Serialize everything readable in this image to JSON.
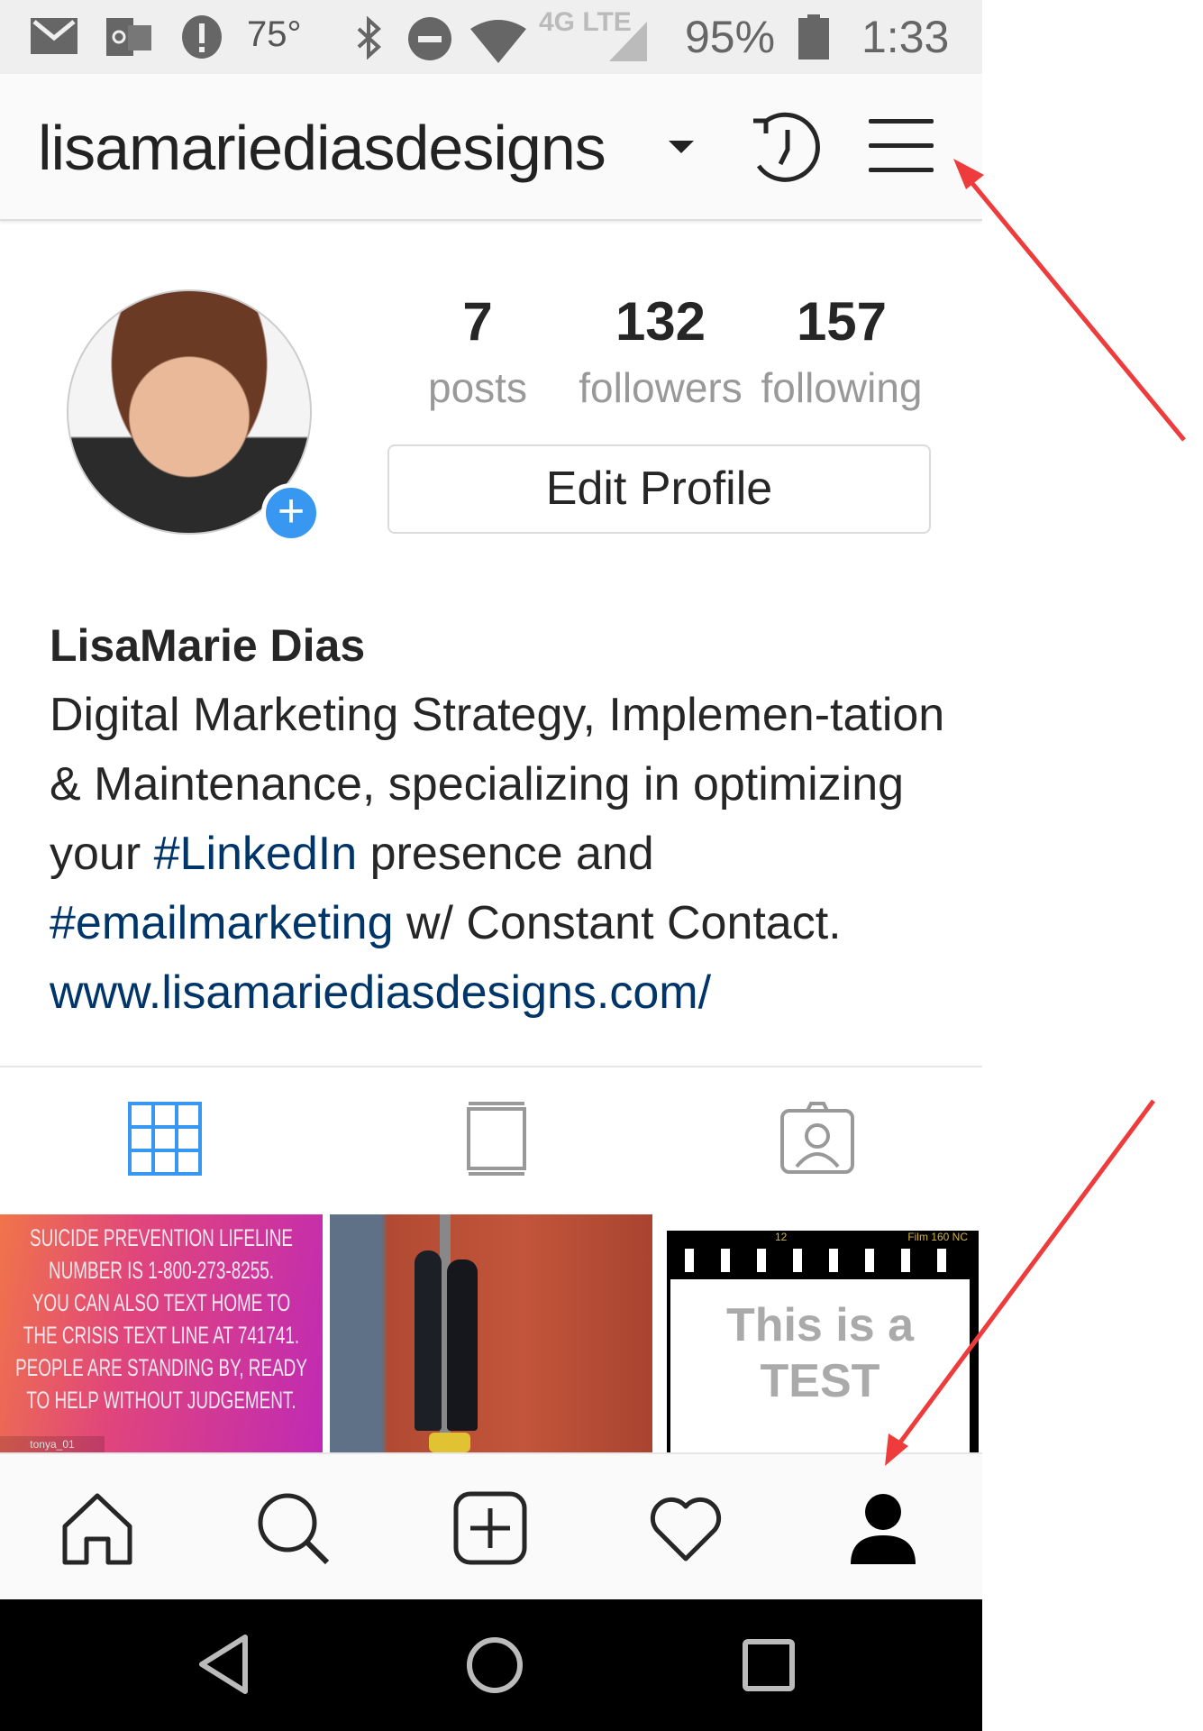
{
  "status_bar": {
    "temperature": "75°",
    "network": "4G LTE",
    "battery": "95%",
    "time": "1:33",
    "icons": [
      "gmail-icon",
      "outlook-icon",
      "alert-icon",
      "bluetooth-icon",
      "do-not-disturb-icon",
      "wifi-icon",
      "signal-icon",
      "battery-icon"
    ]
  },
  "header": {
    "username": "lisamariediasdesigns",
    "icons": [
      "dropdown-caret-icon",
      "history-icon",
      "hamburger-menu-icon"
    ]
  },
  "profile": {
    "stats": [
      {
        "value": "7",
        "label": "posts"
      },
      {
        "value": "132",
        "label": "followers"
      },
      {
        "value": "157",
        "label": "following"
      }
    ],
    "edit_button": "Edit Profile",
    "name": "LisaMarie Dias",
    "bio_1": "Digital Marketing Strategy, Implemen-tation & Maintenance, specializing in optimizing your ",
    "hashtag_1": "#LinkedIn",
    "bio_2": " presence and ",
    "hashtag_2": "#emailmarketing",
    "bio_3": " w/ Constant Contact.",
    "website": "www.lisamariediasdesigns.com/"
  },
  "tabs": [
    "grid-icon",
    "feed-icon",
    "tagged-icon"
  ],
  "accent": "#3897f0",
  "posts": [
    {
      "text": [
        "SUICIDE PREVENTION LIFELINE",
        "NUMBER IS 1-800-273-8255.",
        "YOU CAN ALSO TEXT HOME TO",
        "THE CRISIS TEXT LINE AT 741741.",
        "PEOPLE ARE STANDING BY, READY",
        "TO HELP WITHOUT JUDGEMENT."
      ],
      "credit": "tonya_01"
    },
    {
      "text": []
    },
    {
      "frame_number": "12",
      "film_label": "Film 160 NC",
      "text": [
        "This is a",
        "TEST"
      ]
    }
  ],
  "bottom_nav": [
    "home-icon",
    "search-icon",
    "new-post-icon",
    "activity-heart-icon",
    "profile-icon"
  ]
}
